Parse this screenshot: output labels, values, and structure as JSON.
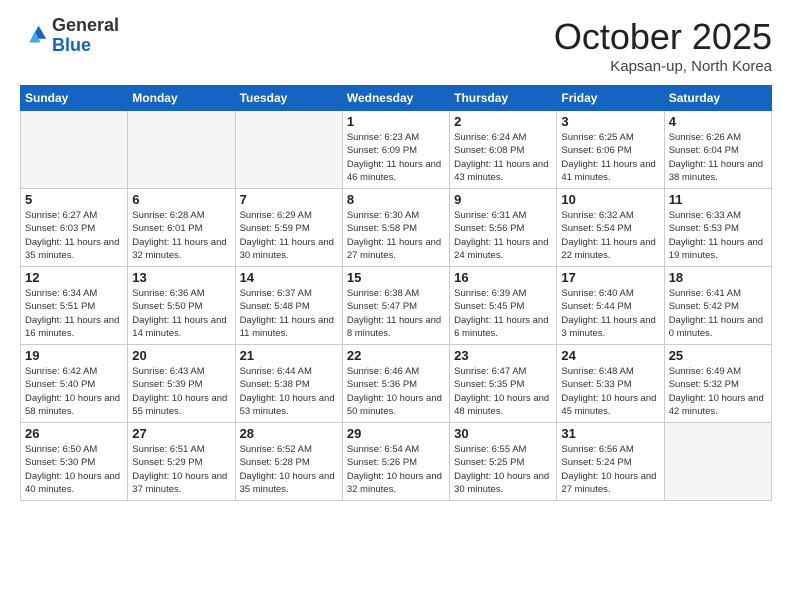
{
  "header": {
    "logo_general": "General",
    "logo_blue": "Blue",
    "month": "October 2025",
    "location": "Kapsan-up, North Korea"
  },
  "days_of_week": [
    "Sunday",
    "Monday",
    "Tuesday",
    "Wednesday",
    "Thursday",
    "Friday",
    "Saturday"
  ],
  "weeks": [
    [
      {
        "day": "",
        "info": ""
      },
      {
        "day": "",
        "info": ""
      },
      {
        "day": "",
        "info": ""
      },
      {
        "day": "1",
        "info": "Sunrise: 6:23 AM\nSunset: 6:09 PM\nDaylight: 11 hours\nand 46 minutes."
      },
      {
        "day": "2",
        "info": "Sunrise: 6:24 AM\nSunset: 6:08 PM\nDaylight: 11 hours\nand 43 minutes."
      },
      {
        "day": "3",
        "info": "Sunrise: 6:25 AM\nSunset: 6:06 PM\nDaylight: 11 hours\nand 41 minutes."
      },
      {
        "day": "4",
        "info": "Sunrise: 6:26 AM\nSunset: 6:04 PM\nDaylight: 11 hours\nand 38 minutes."
      }
    ],
    [
      {
        "day": "5",
        "info": "Sunrise: 6:27 AM\nSunset: 6:03 PM\nDaylight: 11 hours\nand 35 minutes."
      },
      {
        "day": "6",
        "info": "Sunrise: 6:28 AM\nSunset: 6:01 PM\nDaylight: 11 hours\nand 32 minutes."
      },
      {
        "day": "7",
        "info": "Sunrise: 6:29 AM\nSunset: 5:59 PM\nDaylight: 11 hours\nand 30 minutes."
      },
      {
        "day": "8",
        "info": "Sunrise: 6:30 AM\nSunset: 5:58 PM\nDaylight: 11 hours\nand 27 minutes."
      },
      {
        "day": "9",
        "info": "Sunrise: 6:31 AM\nSunset: 5:56 PM\nDaylight: 11 hours\nand 24 minutes."
      },
      {
        "day": "10",
        "info": "Sunrise: 6:32 AM\nSunset: 5:54 PM\nDaylight: 11 hours\nand 22 minutes."
      },
      {
        "day": "11",
        "info": "Sunrise: 6:33 AM\nSunset: 5:53 PM\nDaylight: 11 hours\nand 19 minutes."
      }
    ],
    [
      {
        "day": "12",
        "info": "Sunrise: 6:34 AM\nSunset: 5:51 PM\nDaylight: 11 hours\nand 16 minutes."
      },
      {
        "day": "13",
        "info": "Sunrise: 6:36 AM\nSunset: 5:50 PM\nDaylight: 11 hours\nand 14 minutes."
      },
      {
        "day": "14",
        "info": "Sunrise: 6:37 AM\nSunset: 5:48 PM\nDaylight: 11 hours\nand 11 minutes."
      },
      {
        "day": "15",
        "info": "Sunrise: 6:38 AM\nSunset: 5:47 PM\nDaylight: 11 hours\nand 8 minutes."
      },
      {
        "day": "16",
        "info": "Sunrise: 6:39 AM\nSunset: 5:45 PM\nDaylight: 11 hours\nand 6 minutes."
      },
      {
        "day": "17",
        "info": "Sunrise: 6:40 AM\nSunset: 5:44 PM\nDaylight: 11 hours\nand 3 minutes."
      },
      {
        "day": "18",
        "info": "Sunrise: 6:41 AM\nSunset: 5:42 PM\nDaylight: 11 hours\nand 0 minutes."
      }
    ],
    [
      {
        "day": "19",
        "info": "Sunrise: 6:42 AM\nSunset: 5:40 PM\nDaylight: 10 hours\nand 58 minutes."
      },
      {
        "day": "20",
        "info": "Sunrise: 6:43 AM\nSunset: 5:39 PM\nDaylight: 10 hours\nand 55 minutes."
      },
      {
        "day": "21",
        "info": "Sunrise: 6:44 AM\nSunset: 5:38 PM\nDaylight: 10 hours\nand 53 minutes."
      },
      {
        "day": "22",
        "info": "Sunrise: 6:46 AM\nSunset: 5:36 PM\nDaylight: 10 hours\nand 50 minutes."
      },
      {
        "day": "23",
        "info": "Sunrise: 6:47 AM\nSunset: 5:35 PM\nDaylight: 10 hours\nand 48 minutes."
      },
      {
        "day": "24",
        "info": "Sunrise: 6:48 AM\nSunset: 5:33 PM\nDaylight: 10 hours\nand 45 minutes."
      },
      {
        "day": "25",
        "info": "Sunrise: 6:49 AM\nSunset: 5:32 PM\nDaylight: 10 hours\nand 42 minutes."
      }
    ],
    [
      {
        "day": "26",
        "info": "Sunrise: 6:50 AM\nSunset: 5:30 PM\nDaylight: 10 hours\nand 40 minutes."
      },
      {
        "day": "27",
        "info": "Sunrise: 6:51 AM\nSunset: 5:29 PM\nDaylight: 10 hours\nand 37 minutes."
      },
      {
        "day": "28",
        "info": "Sunrise: 6:52 AM\nSunset: 5:28 PM\nDaylight: 10 hours\nand 35 minutes."
      },
      {
        "day": "29",
        "info": "Sunrise: 6:54 AM\nSunset: 5:26 PM\nDaylight: 10 hours\nand 32 minutes."
      },
      {
        "day": "30",
        "info": "Sunrise: 6:55 AM\nSunset: 5:25 PM\nDaylight: 10 hours\nand 30 minutes."
      },
      {
        "day": "31",
        "info": "Sunrise: 6:56 AM\nSunset: 5:24 PM\nDaylight: 10 hours\nand 27 minutes."
      },
      {
        "day": "",
        "info": ""
      }
    ]
  ]
}
